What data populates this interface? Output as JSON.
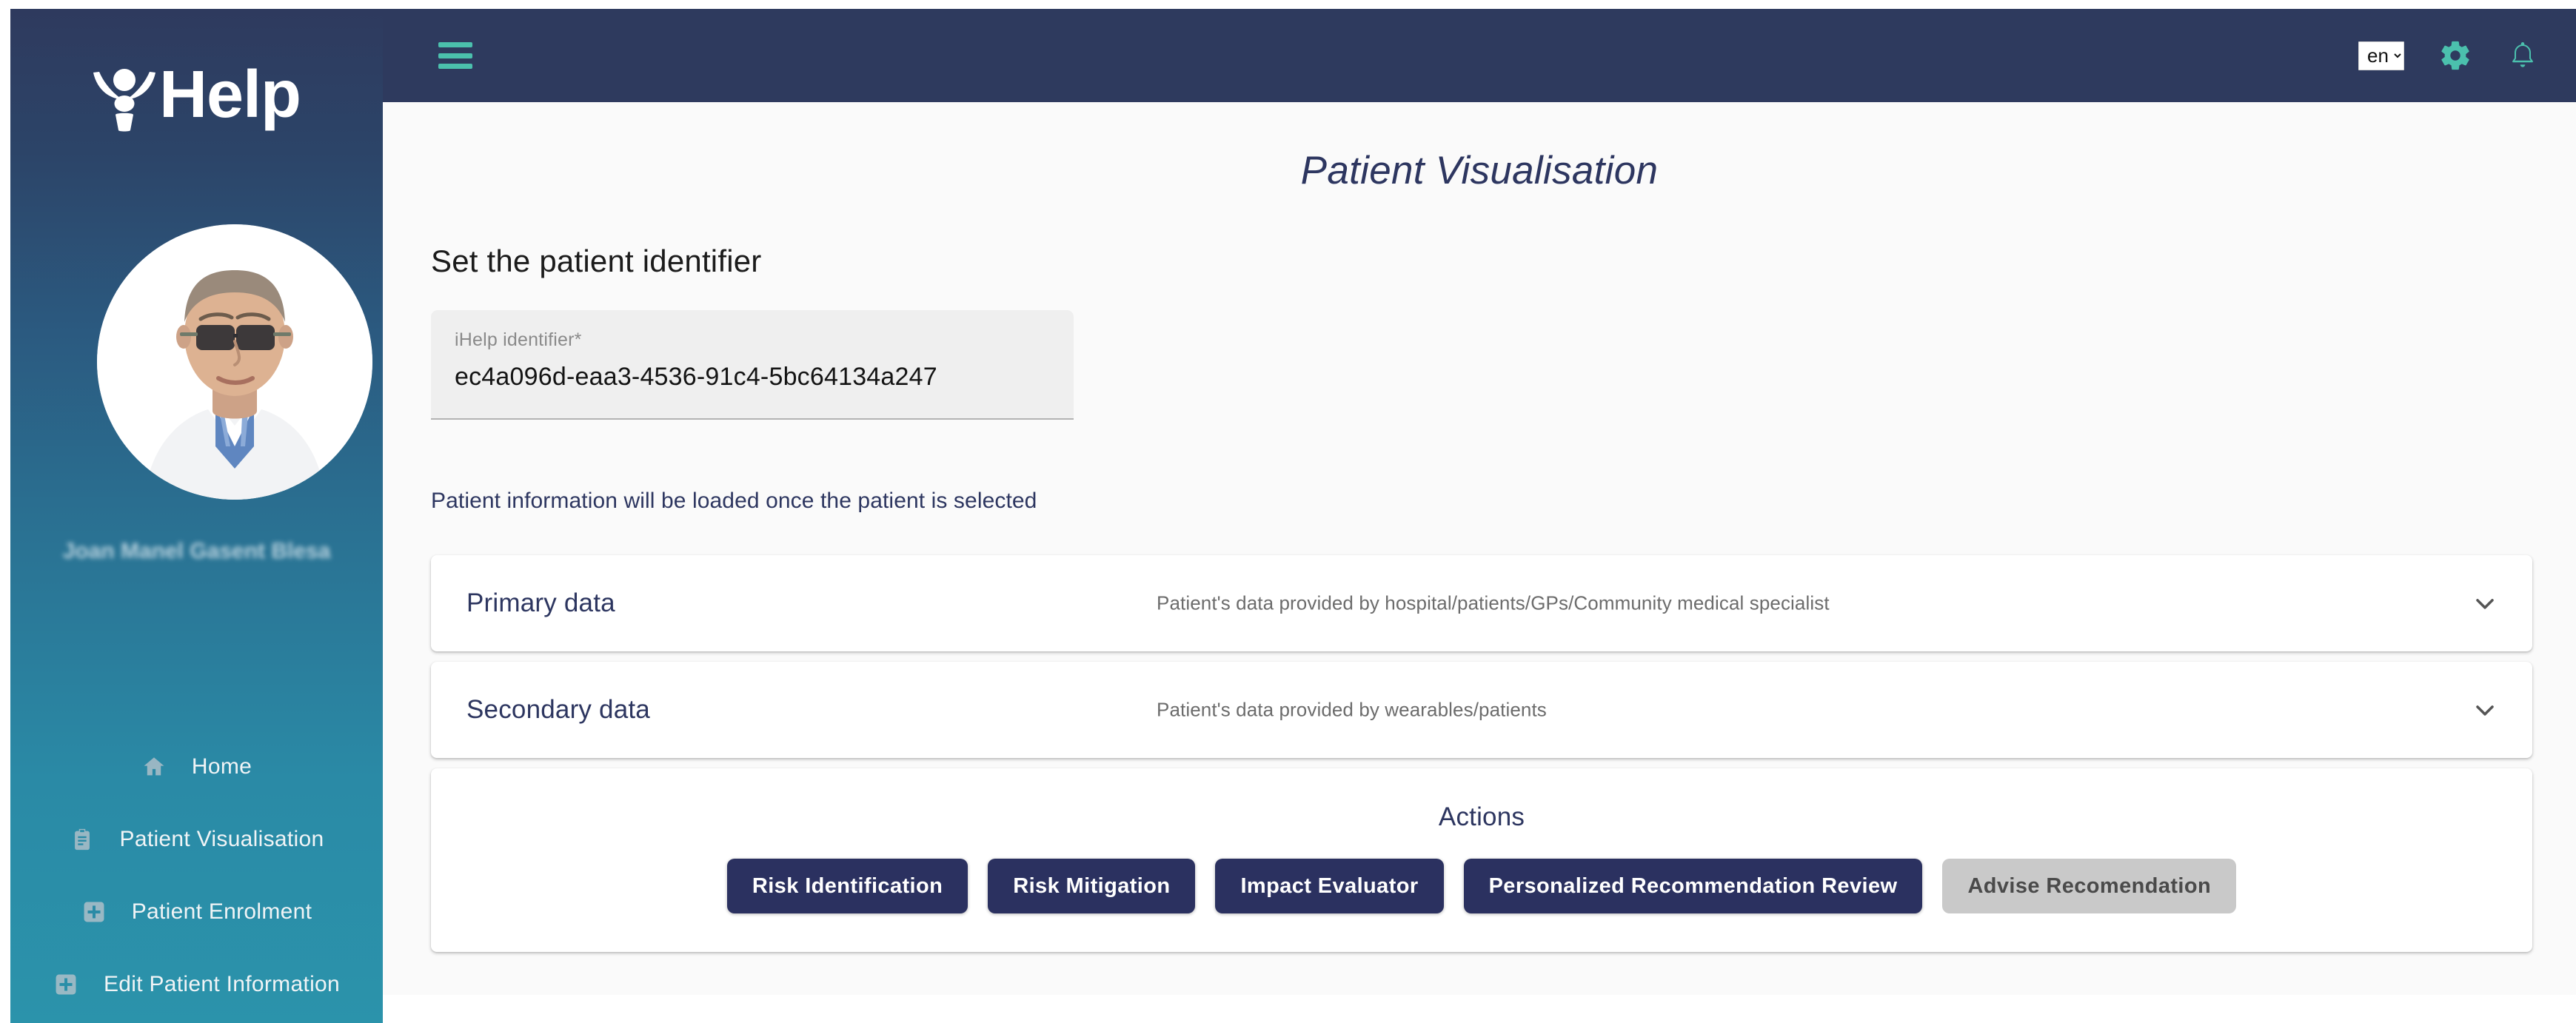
{
  "brand": {
    "name": "Help",
    "logo_icon": "ihelp-person-logo"
  },
  "sidebar": {
    "user_name": "Joan Manel Gasent Blesa",
    "avatar_icon": "doctor-avatar-photo",
    "items": [
      {
        "label": "Home",
        "icon": "home-icon"
      },
      {
        "label": "Patient Visualisation",
        "icon": "clipboard-icon"
      },
      {
        "label": "Patient Enrolment",
        "icon": "plus-square-icon"
      },
      {
        "label": "Edit Patient Information",
        "icon": "plus-square-icon"
      }
    ]
  },
  "topbar": {
    "menu_icon": "hamburger-menu-icon",
    "language": "en",
    "language_options": [
      "en"
    ],
    "settings_icon": "gear-icon",
    "notifications_icon": "bell-icon"
  },
  "main": {
    "page_title": "Patient Visualisation",
    "section_heading": "Set the patient identifier",
    "identifier_field": {
      "label": "iHelp identifier*",
      "value": "ec4a096d-eaa3-4536-91c4-5bc64134a247",
      "placeholder": "iHelp identifier*"
    },
    "load_note": "Patient information will be loaded once the patient is selected",
    "accordions": [
      {
        "title": "Primary data",
        "description": "Patient's data provided by hospital/patients/GPs/Community medical specialist",
        "chevron_icon": "chevron-down-icon"
      },
      {
        "title": "Secondary data",
        "description": "Patient's data provided by wearables/patients",
        "chevron_icon": "chevron-down-icon"
      }
    ],
    "actions": {
      "title": "Actions",
      "buttons": [
        {
          "label": "Risk Identification",
          "disabled": false
        },
        {
          "label": "Risk Mitigation",
          "disabled": false
        },
        {
          "label": "Impact Evaluator",
          "disabled": false
        },
        {
          "label": "Personalized Recommendation Review",
          "disabled": false
        },
        {
          "label": "Advise Recomendation",
          "disabled": true
        }
      ]
    }
  },
  "colors": {
    "sidebar_top": "#2e3a5e",
    "sidebar_bottom": "#2b93ab",
    "topbar": "#2e3a5e",
    "accent_teal": "#4bc0ad",
    "primary_navy": "#2b3160",
    "page_bg": "#fafafa",
    "disabled_gray": "#c9c9c9"
  }
}
